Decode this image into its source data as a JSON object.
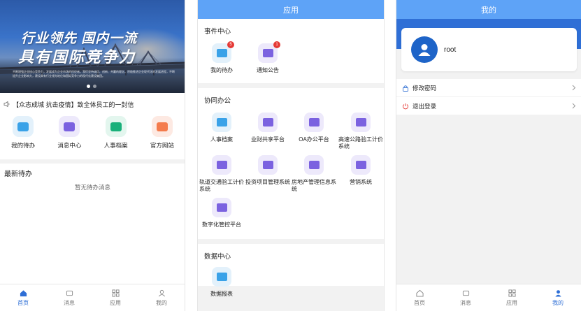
{
  "home": {
    "banner": {
      "line1": "行业领先  国内一流",
      "line2": "具有国际竞争力",
      "fine": "不断增强企业核心竞争力，发展成为企业市场的佼佼者。我们坚持诚信、创新、共赢的理念，积极推进企业现代化的发展进程，不断提升企业影响力，建设具有行业领先地位和国际竞争力的现代化建设集团。"
    },
    "notice": "【众志成城 抗击疫情】致全体员工的一封信",
    "quick": [
      {
        "label": "我的待办",
        "color": "#e3f1fb",
        "inner": "#3aa2e8"
      },
      {
        "label": "消息中心",
        "color": "#ede9fb",
        "inner": "#7b62e0"
      },
      {
        "label": "人事档案",
        "color": "#e3f6ee",
        "inner": "#19b07a"
      },
      {
        "label": "官方网站",
        "color": "#fde9e2",
        "inner": "#f47b4c"
      }
    ],
    "todo_title": "最新待办",
    "todo_empty": "暂无待办消息"
  },
  "apps": {
    "title": "应用",
    "events": {
      "title": "事件中心",
      "items": [
        {
          "label": "我的待办",
          "badge": "5"
        },
        {
          "label": "通知公告",
          "badge": "1"
        }
      ]
    },
    "office": {
      "title": "协同办公",
      "items": [
        {
          "label": "人事档案"
        },
        {
          "label": "业财共享平台"
        },
        {
          "label": "OA办公平台"
        },
        {
          "label": "高速公路验工计价系统"
        },
        {
          "label": "轨道交通验工计价系统"
        },
        {
          "label": "投资项目管理系统"
        },
        {
          "label": "房地产管理信息系统"
        },
        {
          "label": "营销系统"
        },
        {
          "label": "数字化管控平台"
        }
      ]
    },
    "data": {
      "title": "数据中心",
      "items": [
        {
          "label": "数据报表"
        }
      ]
    }
  },
  "mine": {
    "title": "我的",
    "username": "root",
    "menu": [
      {
        "label": "修改密码",
        "icon": "lock-icon"
      },
      {
        "label": "退出登录",
        "icon": "power-icon"
      }
    ]
  },
  "tabs": [
    "首页",
    "消息",
    "应用",
    "我的"
  ],
  "colors": {
    "primary": "#2f6fd6",
    "navbar": "#5ea3f7",
    "badge": "#e53935"
  }
}
